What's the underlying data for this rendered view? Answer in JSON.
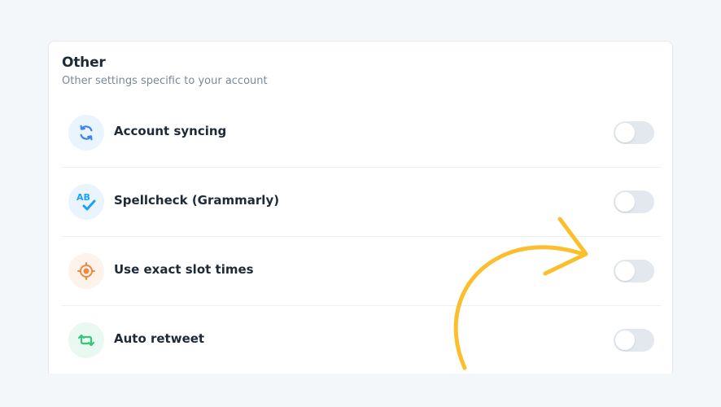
{
  "section": {
    "title": "Other",
    "subtitle": "Other settings specific to your account"
  },
  "settings": [
    {
      "label": "Account syncing",
      "icon": "sync-icon",
      "icon_color": "#3b82f6",
      "icon_bg": "#eaf4fc",
      "enabled": false
    },
    {
      "label": "Spellcheck (Grammarly)",
      "icon": "spellcheck-icon",
      "icon_color": "#1da1f2",
      "icon_bg": "#eaf4fc",
      "enabled": false
    },
    {
      "label": "Use exact slot times",
      "icon": "target-icon",
      "icon_color": "#f0883e",
      "icon_bg": "#fdf3ea",
      "enabled": false
    },
    {
      "label": "Auto retweet",
      "icon": "retweet-icon",
      "icon_color": "#34c77b",
      "icon_bg": "#e9f8f0",
      "enabled": false
    }
  ],
  "spellcheck_icon_text": "AB",
  "colors": {
    "arrow": "#fbbf2e",
    "toggle_off": "#e3e8ef"
  }
}
